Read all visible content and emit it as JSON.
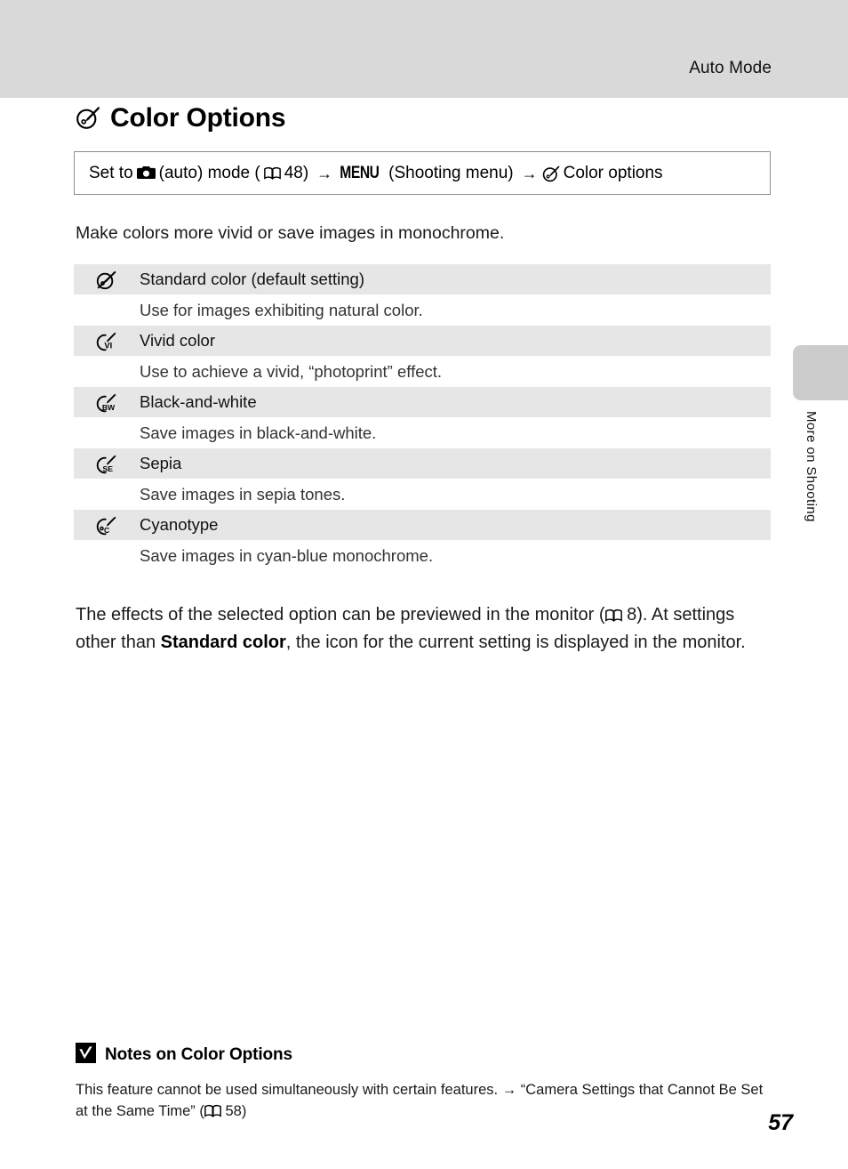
{
  "header": {
    "running_title": "Auto Mode"
  },
  "side_tab": {
    "label": "More on Shooting"
  },
  "section": {
    "icon": "color-options-icon",
    "title": "Color Options"
  },
  "path_box": {
    "prefix": "Set to",
    "camera_icon": "camera-icon",
    "auto_mode": "(auto) mode (",
    "book_icon": "book-icon",
    "page_ref": "48)",
    "arrow1": "→",
    "menu_word": "MENU",
    "shooting_menu": "(Shooting menu)",
    "arrow2": "→",
    "color_icon": "color-options-icon",
    "destination": "Color options"
  },
  "intro": "Make colors more vivid or save images in monochrome.",
  "options": [
    {
      "icon": "color-standard-icon",
      "icon_label": "",
      "name": "Standard color (default setting)",
      "description": "Use for images exhibiting natural color."
    },
    {
      "icon": "color-vivid-icon",
      "icon_label": "VI",
      "name": "Vivid color",
      "description": "Use to achieve a vivid, “photoprint” effect."
    },
    {
      "icon": "color-bw-icon",
      "icon_label": "BW",
      "name": "Black-and-white",
      "description": "Save images in black-and-white."
    },
    {
      "icon": "color-sepia-icon",
      "icon_label": "SE",
      "name": "Sepia",
      "description": "Save images in sepia tones."
    },
    {
      "icon": "color-cyanotype-icon",
      "icon_label": "C",
      "name": "Cyanotype",
      "description": "Save images in cyan-blue monochrome."
    }
  ],
  "body": {
    "part1": "The effects of the selected option can be previewed in the monitor (",
    "book_icon": "book-icon",
    "page_ref": "8). At settings other than ",
    "bold_term": "Standard color",
    "part2": ", the icon for the current setting is displayed in the monitor."
  },
  "notes": {
    "icon": "caution-checkmark-icon",
    "title": "Notes on Color Options",
    "text_part1": "This feature cannot be used simultaneously with certain features. ",
    "arrow": "→",
    "text_part2": " “Camera Settings that Cannot Be Set at the Same Time” (",
    "book_icon2": "book-icon",
    "page_ref": "58)"
  },
  "page_number": "57",
  "colors": {
    "header_band": "#d9d9d9",
    "row_shade": "#e6e6e6",
    "side_tab": "#cccccc",
    "box_border": "#8d8d8d"
  }
}
